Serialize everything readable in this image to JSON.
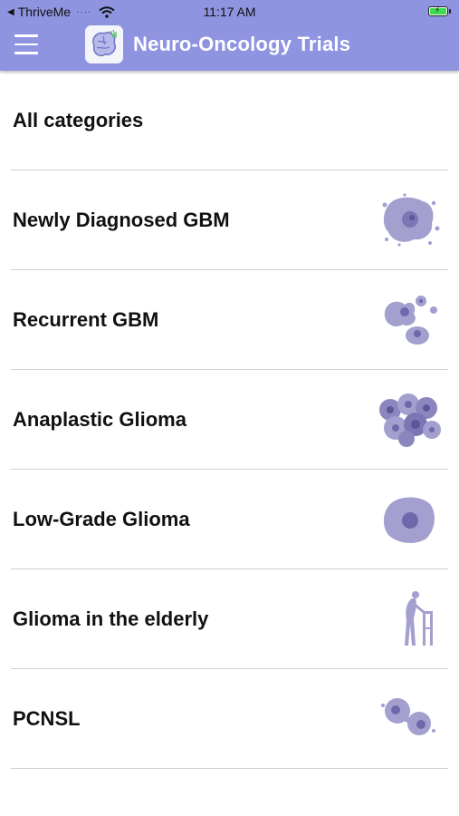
{
  "status_bar": {
    "carrier": "ThriveMe",
    "time": "11:17 AM"
  },
  "header": {
    "title": "Neuro-Oncology Trials"
  },
  "colors": {
    "header": "#8e94e0",
    "icon_tint": "#9a94c8",
    "divider": "#cfcfcf"
  },
  "categories": [
    {
      "label": "All categories"
    },
    {
      "label": "Newly Diagnosed GBM",
      "icon": "cell-cluster-icon"
    },
    {
      "label": "Recurrent GBM",
      "icon": "cell-blob-icon"
    },
    {
      "label": "Anaplastic Glioma",
      "icon": "cell-mass-icon"
    },
    {
      "label": "Low-Grade Glioma",
      "icon": "single-cell-icon"
    },
    {
      "label": "Glioma in the elderly",
      "icon": "elderly-walker-icon"
    },
    {
      "label": "PCNSL",
      "icon": "dividing-cell-icon"
    }
  ]
}
